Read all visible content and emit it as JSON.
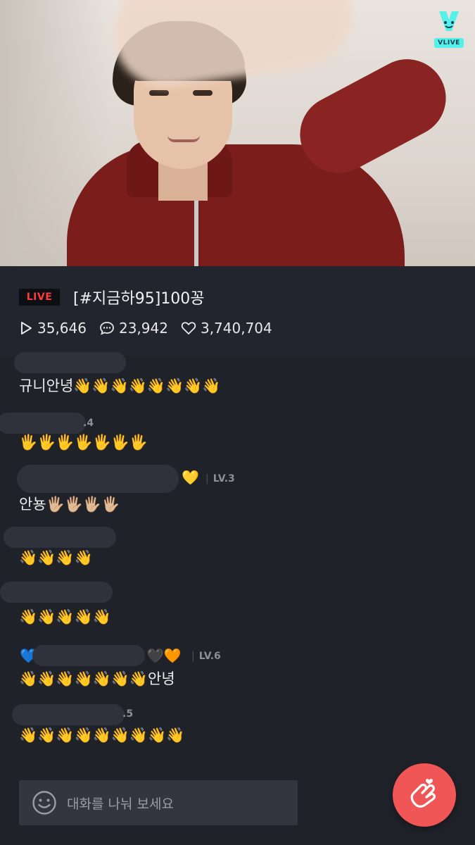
{
  "logo": {
    "text": "VLIVE"
  },
  "broadcast": {
    "live_label": "LIVE",
    "title": "[#지금하95]100꽁",
    "plays": "35,646",
    "comments": "23,942",
    "hearts": "3,740,704"
  },
  "chat": {
    "items": [
      {
        "message": "규니안녕👋👋👋👋👋👋👋👋"
      },
      {
        "level": ".4",
        "message": "🖐🖐🖐🖐🖐🖐🖐"
      },
      {
        "level": "LV.3",
        "name_emoji": "💛",
        "message": "안뇽🖐🏼🖐🏼🖐🏼🖐🏼"
      },
      {
        "message": "👋👋👋👋"
      },
      {
        "message": "👋👋👋👋👋"
      },
      {
        "level": "LV.6",
        "name_emoji_left": "💙",
        "name_emoji_right": "🖤🧡",
        "message": "👋👋👋👋👋👋👋안녕"
      },
      {
        "level": ".5",
        "message": "👋👋👋👋👋👋👋👋👋"
      }
    ]
  },
  "input": {
    "placeholder": "대화를 나눠 보세요"
  },
  "colors": {
    "live_red": "#ff3b3b",
    "heart_button": "#f05656",
    "background": "#20222a"
  }
}
